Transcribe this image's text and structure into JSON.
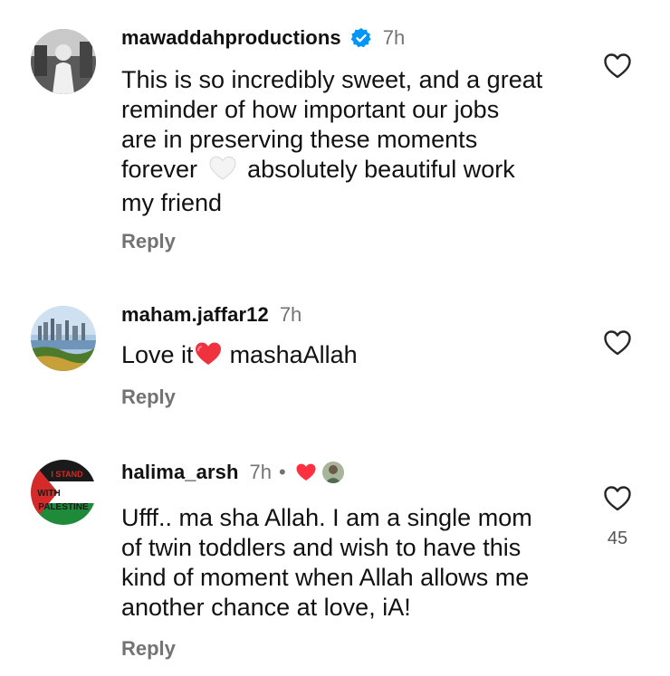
{
  "comments": [
    {
      "username": "mawaddahproductions",
      "verified": true,
      "time": "7h",
      "text_lines": [
        "This is so incredibly sweet, and a great",
        "reminder of how important our jobs",
        "are in preserving these moments",
        "forever",
        "absolutely beautiful work",
        "my friend"
      ],
      "inline_emoji": "white-heart",
      "reply_label": "Reply",
      "likes": ""
    },
    {
      "username": "maham.jaffar12",
      "verified": false,
      "time": "7h",
      "text_before": "Love it",
      "inline_emoji": "red-heart",
      "text_after": "mashaAllah",
      "reply_label": "Reply",
      "likes": ""
    },
    {
      "username": "halima_arsh",
      "verified": false,
      "time": "7h",
      "separator": "•",
      "creator_liked": true,
      "text_lines": [
        "Ufff.. ma sha Allah. I am a single mom",
        "of twin toddlers and wish to have this",
        "kind of moment when Allah allows me",
        "another chance at love, iA!"
      ],
      "reply_label": "Reply",
      "likes": "45",
      "avatar_text": [
        "I STAND",
        "WITH",
        "PALESTINE"
      ]
    }
  ],
  "colors": {
    "verified_blue": "#0095f6",
    "heart_red": "#ff3040",
    "muted": "#737373"
  }
}
